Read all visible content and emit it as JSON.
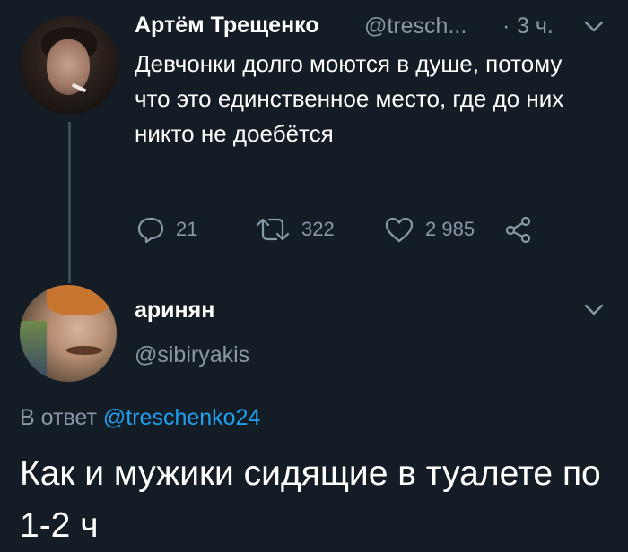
{
  "tweet": {
    "author_name": "Артём Трещенко",
    "author_handle": "@tresch...",
    "separator": "·",
    "time": "3 ч.",
    "text": "Девчонки долго моются в душе, потому что это единственное место, где до них никто не доебётся",
    "reply_count": "21",
    "retweet_count": "322",
    "like_count": "2 985"
  },
  "reply": {
    "author_name": "аринян",
    "author_handle": "@sibiryakis",
    "in_reply_prefix": "В ответ",
    "in_reply_mention": "@treschenko24",
    "text": "Как и мужики сидящие в туалете по 1-2 ч"
  },
  "icons": {
    "tweet_menu": "chevron-down-icon",
    "reply": "reply-bubble-icon",
    "retweet": "retweet-icon",
    "like": "heart-icon",
    "share": "share-icon",
    "reply_menu": "chevron-down-icon"
  },
  "colors": {
    "background": "#141d26",
    "secondary_text": "#8899a6",
    "link": "#1da1f2",
    "thread_line": "#3d4b5a"
  }
}
